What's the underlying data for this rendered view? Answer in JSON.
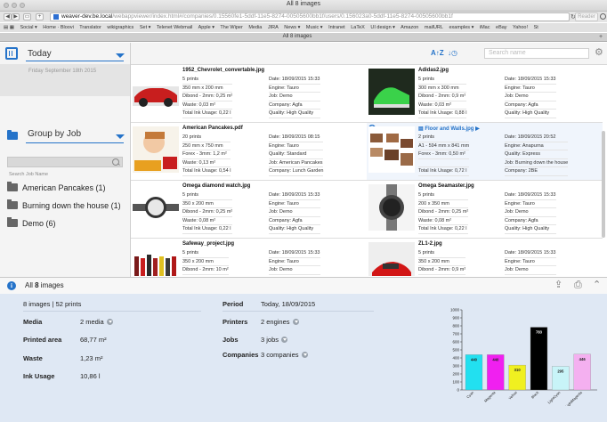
{
  "browser": {
    "window_title": "All 8 images",
    "url_host": "weaver-dev.be.local",
    "url_path": "/webappviewer/index.html#/companies/0.15560fe1-5ddf-11e5-8274-00505600bb1f/users/0.156023a0-5ddf-11e5-8274-00505600bb1f",
    "reader_label": "Reader",
    "bookmarks": [
      "Social ▾",
      "Home · Bloovi",
      "Translator",
      "wikigraphics",
      "Set ▾",
      "Telenet Webmail",
      "Apple ▾",
      "The Wiper",
      "Media",
      "JIRA",
      "News ▾",
      "Music ▾",
      "Intranet",
      "LaTeX",
      "UI design ▾",
      "Amazon",
      "mailURL",
      "examples ▾",
      "iMac",
      "eBay",
      "Yahoo!",
      "St"
    ],
    "tab_title": "All 8 images"
  },
  "sidebar": {
    "date_filter": "Today",
    "date_sub": "Friday September 18th 2015",
    "group_filter": "Group by Job",
    "search_placeholder": "Search Job Name",
    "jobs": [
      {
        "label": "American Pancakes (1)"
      },
      {
        "label": "Burning down the house (1)"
      },
      {
        "label": "Demo (6)"
      }
    ]
  },
  "toolbar": {
    "sort_az": "A↑Z",
    "sort_time": "↓◷",
    "search_placeholder": "Search name"
  },
  "cards": [
    {
      "name": "1952_Chevrolet_convertable.jpg",
      "left": [
        "5 prints",
        "350 mm x 200 mm",
        "Dibond - 2mm: 0,25 m²",
        "Waste: 0,03 m²",
        "Total Ink Usage: 0,22 l"
      ],
      "right": [
        "Date: 18/09/2015 15:33",
        "Engine: Tauro",
        "Job: Demo",
        "Company: Agfa",
        "Quality: High Quality"
      ]
    },
    {
      "name": "Adidas2.jpg",
      "left": [
        "5 prints",
        "300 mm x 300 mm",
        "Dibond - 2mm: 0,9 m²",
        "Waste: 0,03 m²",
        "Total Ink Usage: 0,88 l"
      ],
      "right": [
        "Date: 18/09/2015 15:33",
        "Engine: Tauro",
        "Job: Demo",
        "Company: Agfa",
        "Quality: High Quality"
      ]
    },
    {
      "name": "American Pancakes.pdf",
      "left": [
        "20 prints",
        "250 mm x 750 mm",
        "Forex - 3mm: 1,2 m²",
        "Waste: 0,13 m²",
        "Total Ink Usage: 0,54 l"
      ],
      "right": [
        "Date: 18/09/2015 08:15",
        "Engine: Tauro",
        "Quality: Standard",
        "Job: American Pancakes",
        "Company: Lunch Garden"
      ]
    },
    {
      "name": "Floor and Walls.jpg ▶",
      "badge": "3",
      "left": [
        "2 prints",
        "A1 - 594 mm x 841 mm",
        "Forex - 3mm: 0,50 m²",
        "",
        "Total Ink Usage: 0,72 l"
      ],
      "right": [
        "Date: 18/09/2015 20:52",
        "Engine: Anapurna",
        "Quality: Express",
        "Job: Burning down the house",
        "Company: 2BE"
      ]
    },
    {
      "name": "Omega diamond watch.jpg",
      "left": [
        "5 prints",
        "350 x 200 mm",
        "Dibond - 2mm: 0,25 m²",
        "Waste: 0,08 m²",
        "Total Ink Usage: 0,22 l"
      ],
      "right": [
        "Date: 18/09/2015 15:33",
        "Engine: Tauro",
        "Job: Demo",
        "Company: Agfa",
        "Quality: High Quality"
      ]
    },
    {
      "name": "Omega Seamaster.jpg",
      "left": [
        "5 prints",
        "200 x 350 mm",
        "Dibond - 2mm: 0,25 m²",
        "Waste: 0,08 m²",
        "Total Ink Usage: 0,22 l"
      ],
      "right": [
        "Date: 18/09/2015 15:33",
        "Engine: Tauro",
        "Job: Demo",
        "Company: Agfa",
        "Quality: High Quality"
      ]
    },
    {
      "name": "Safeway_project.jpg",
      "left": [
        "5 prints",
        "350 x 200 mm",
        "Dibond - 2mm: 10 m²"
      ],
      "right": [
        "Date: 18/09/2015 15:33",
        "Engine: Tauro",
        "Job: Demo"
      ]
    },
    {
      "name": "ZL1-2.jpg",
      "left": [
        "5 prints",
        "350 x 200 mm",
        "Dibond - 2mm: 0,9 m²"
      ],
      "right": [
        "Date: 18/09/2015 15:33",
        "Engine: Tauro",
        "Job: Demo"
      ]
    }
  ],
  "summary": {
    "title_prefix": "All ",
    "title_count": "8",
    "title_suffix": " images",
    "count_prefix": "8",
    "count_mid": " images | ",
    "count_prints": "52",
    "count_suffix": " prints",
    "media_label": "Media",
    "media_value": "2 media",
    "area_label": "Printed area",
    "area_value": "68,77",
    "area_unit": "m²",
    "waste_label": "Waste",
    "waste_value": "1,23",
    "waste_unit": "m²",
    "ink_label": "Ink Usage",
    "ink_value": "10,86",
    "ink_unit": "l",
    "period_label": "Period",
    "period_value": "Today, 18/09/2015",
    "printers_label": "Printers",
    "printers_value": "2 engines",
    "jobs_label": "Jobs",
    "jobs_value": "3 jobs",
    "companies_label": "Companies",
    "companies_value": "3 companies"
  },
  "colors": {
    "accent": "#2573c9"
  },
  "chart_data": {
    "type": "bar",
    "categories": [
      "Cyan",
      "Magenta",
      "Yellow",
      "Black",
      "LightCyan",
      "LightMagenta"
    ],
    "values": [
      440,
      440,
      310,
      783,
      295,
      446
    ],
    "colors": [
      "#22e0f0",
      "#f020f0",
      "#f0f020",
      "#000000",
      "#c8f4f8",
      "#f4b0f0"
    ],
    "ylim": [
      0,
      1000
    ],
    "yticks": [
      0,
      100,
      200,
      300,
      400,
      500,
      600,
      700,
      800,
      900,
      1000
    ],
    "grid": false,
    "legend": "none"
  }
}
